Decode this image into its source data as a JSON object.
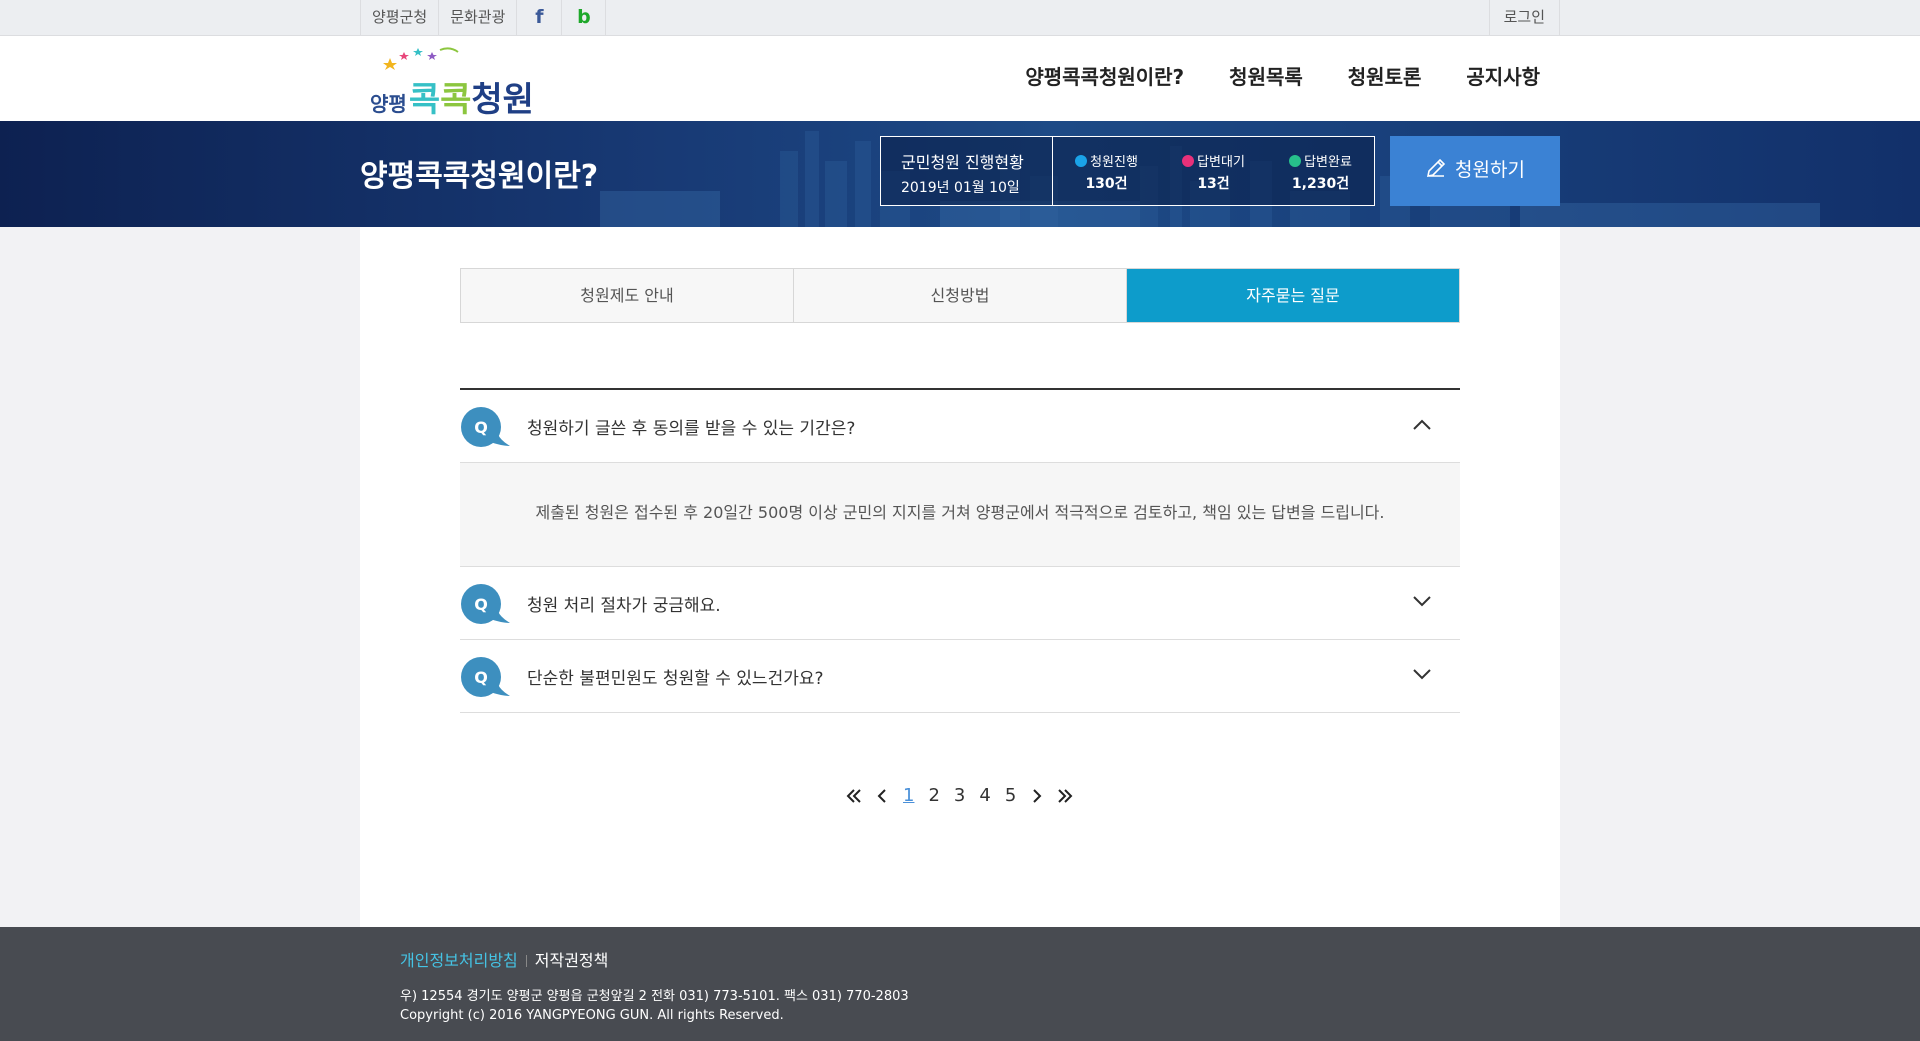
{
  "topbar": {
    "links": [
      "양평군청",
      "문화관광"
    ],
    "facebook_glyph": "f",
    "band_glyph": "b",
    "login": "로그인"
  },
  "header": {
    "logo": {
      "part1": "양평",
      "part2": "콕",
      "part3": "콕",
      "part4": "청원"
    },
    "nav": [
      "양평콕콕청원이란?",
      "청원목록",
      "청원토론",
      "공지사항"
    ]
  },
  "banner": {
    "title": "양평콕콕청원이란?",
    "status_title": "군민청원 진행현황",
    "status_date": "2019년 01월 10일",
    "stats": [
      {
        "label": "청원진행",
        "value": "130건",
        "color": "#1aa3e8"
      },
      {
        "label": "답변대기",
        "value": "13건",
        "color": "#e8317a"
      },
      {
        "label": "답변완료",
        "value": "1,230건",
        "color": "#27c08b"
      }
    ],
    "write_button": "청원하기"
  },
  "tabs": [
    {
      "label": "청원제도 안내",
      "active": false
    },
    {
      "label": "신청방법",
      "active": false
    },
    {
      "label": "자주묻는 질문",
      "active": true
    }
  ],
  "faq": {
    "q_badge": "Q",
    "items": [
      {
        "question": "청원하기 글쓴 후 동의를 받을 수 있는 기간은?",
        "answer": "제출된 청원은 접수된 후 20일간 500명 이상 군민의 지지를 거쳐 양평군에서 적극적으로 검토하고, 책임 있는 답변을 드립니다.",
        "expanded": true
      },
      {
        "question": "청원 처리 절차가 궁금해요.",
        "expanded": false
      },
      {
        "question": "단순한 불편민원도 청원할 수 있느건가요?",
        "expanded": false
      }
    ]
  },
  "pagination": {
    "pages": [
      "1",
      "2",
      "3",
      "4",
      "5"
    ],
    "current": "1"
  },
  "footer": {
    "privacy": "개인정보처리방침",
    "copyright_policy": "저작권정책",
    "address": "우) 12554 경기도 양평군 양평읍 군청앞길 2 전화 031) 773-5101. 팩스 031) 770-2803",
    "copyright": "Copyright (c) 2016 YANGPYEONG GUN. All rights Reserved."
  },
  "colors": {
    "accent": "#0d9ccb",
    "write_button": "#3b82d4",
    "q_badge": "#3d8fbf",
    "footer_bg": "#484b51"
  }
}
